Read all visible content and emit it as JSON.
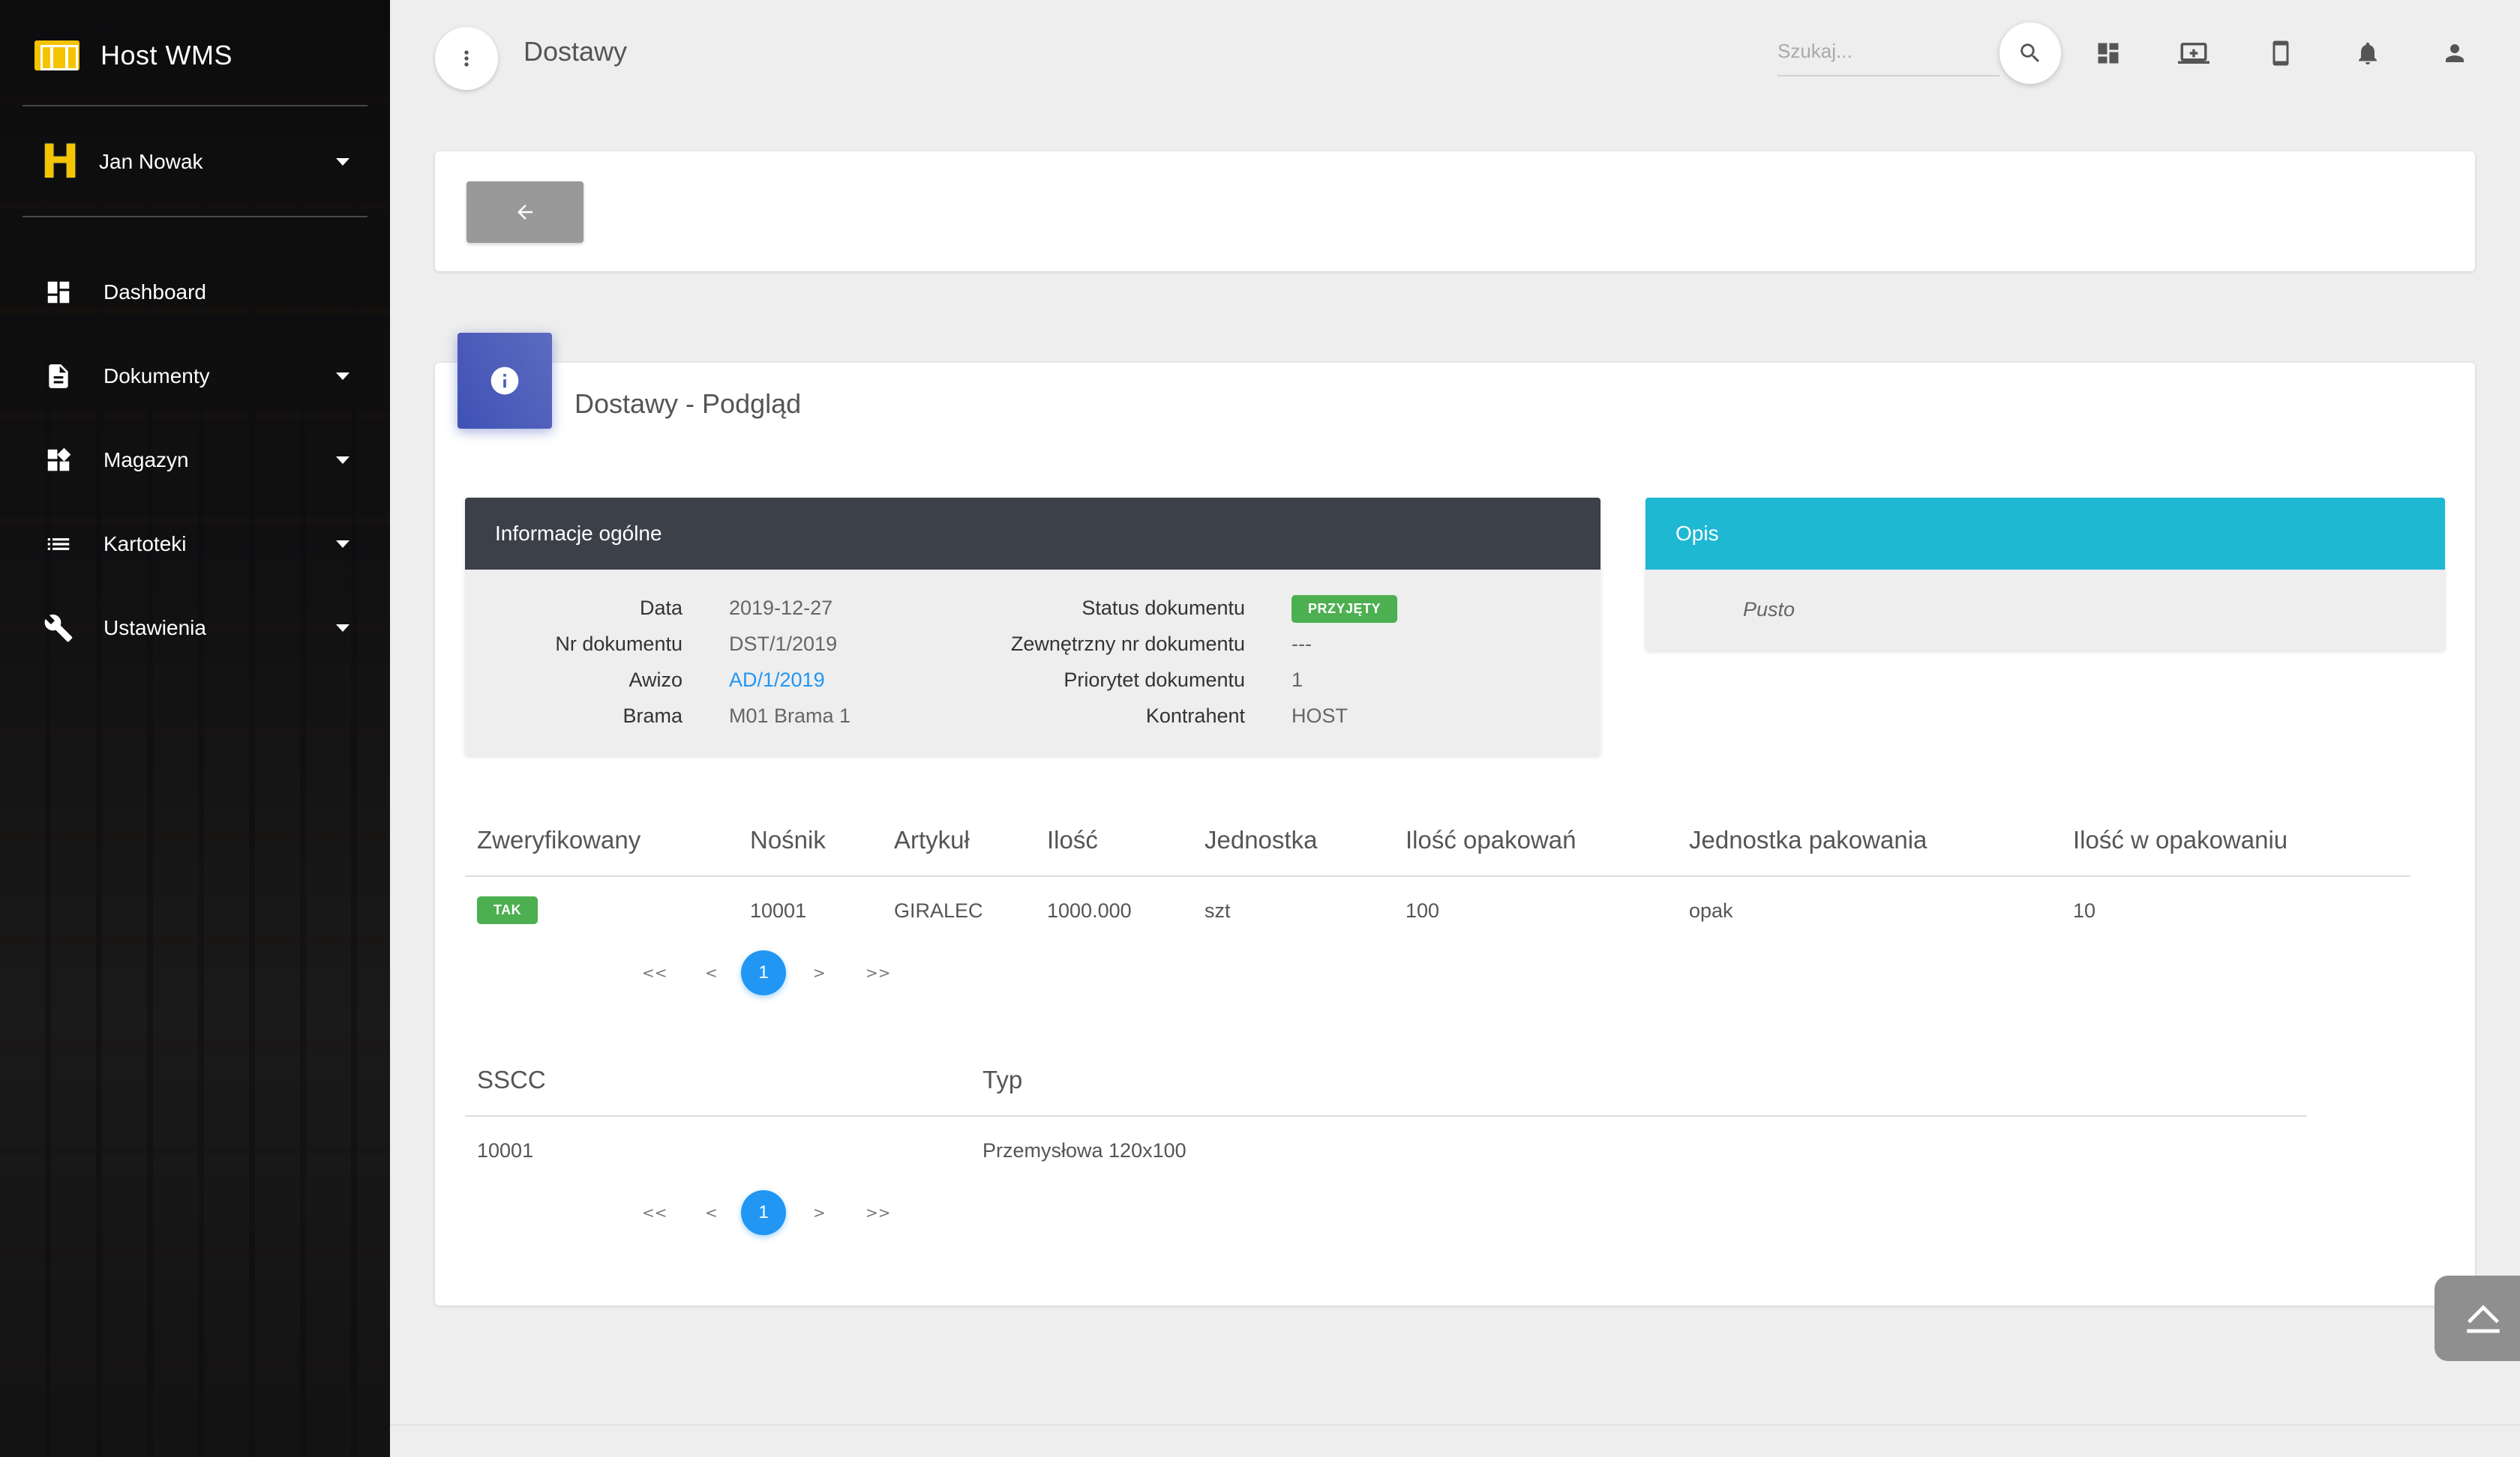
{
  "app": {
    "name": "Host WMS"
  },
  "user": {
    "name": "Jan Nowak"
  },
  "sidebar": {
    "items": [
      {
        "label": "Dashboard",
        "icon": "dashboard-icon",
        "has_caret": false
      },
      {
        "label": "Dokumenty",
        "icon": "document-icon",
        "has_caret": true
      },
      {
        "label": "Magazyn",
        "icon": "widgets-icon",
        "has_caret": true
      },
      {
        "label": "Kartoteki",
        "icon": "list-icon",
        "has_caret": true
      },
      {
        "label": "Ustawienia",
        "icon": "wrench-icon",
        "has_caret": true
      }
    ]
  },
  "header": {
    "title": "Dostawy",
    "search_placeholder": "Szukaj..."
  },
  "card": {
    "title": "Dostawy - Podgląd"
  },
  "info": {
    "heading": "Informacje ogólne",
    "left": [
      {
        "label": "Data",
        "value": "2019-12-27"
      },
      {
        "label": "Nr dokumentu",
        "value": "DST/1/2019"
      },
      {
        "label": "Awizo",
        "value": "AD/1/2019"
      },
      {
        "label": "Brama",
        "value": "M01 Brama 1"
      }
    ],
    "right": [
      {
        "label": "Status dokumentu",
        "value": "PRZYJĘTY"
      },
      {
        "label": "Zewnętrzny nr dokumentu",
        "value": "---"
      },
      {
        "label": "Priorytet dokumentu",
        "value": "1"
      },
      {
        "label": "Kontrahent",
        "value": "HOST"
      }
    ]
  },
  "description": {
    "heading": "Opis",
    "text": "Pusto"
  },
  "items_table": {
    "headers": [
      "Zweryfikowany",
      "Nośnik",
      "Artykuł",
      "Ilość",
      "Jednostka",
      "Ilość opakowań",
      "Jednostka pakowania",
      "Ilość w opakowaniu"
    ],
    "rows": [
      [
        "TAK",
        "10001",
        "GIRALEC",
        "1000.000",
        "szt",
        "100",
        "opak",
        "10"
      ]
    ],
    "pager": {
      "first": "<<",
      "prev": "<",
      "page": "1",
      "next": ">",
      "last": ">>"
    }
  },
  "carriers_table": {
    "headers": [
      "SSCC",
      "Typ"
    ],
    "rows": [
      [
        "10001",
        "Przemysłowa 120x100"
      ]
    ],
    "pager": {
      "first": "<<",
      "prev": "<",
      "page": "1",
      "next": ">",
      "last": ">>"
    }
  },
  "colors": {
    "primary": "#2196f3",
    "success": "#4caf50",
    "info": "#1eb8d3",
    "card_icon": "#3f51b5",
    "panel_dark": "#3c4048"
  }
}
